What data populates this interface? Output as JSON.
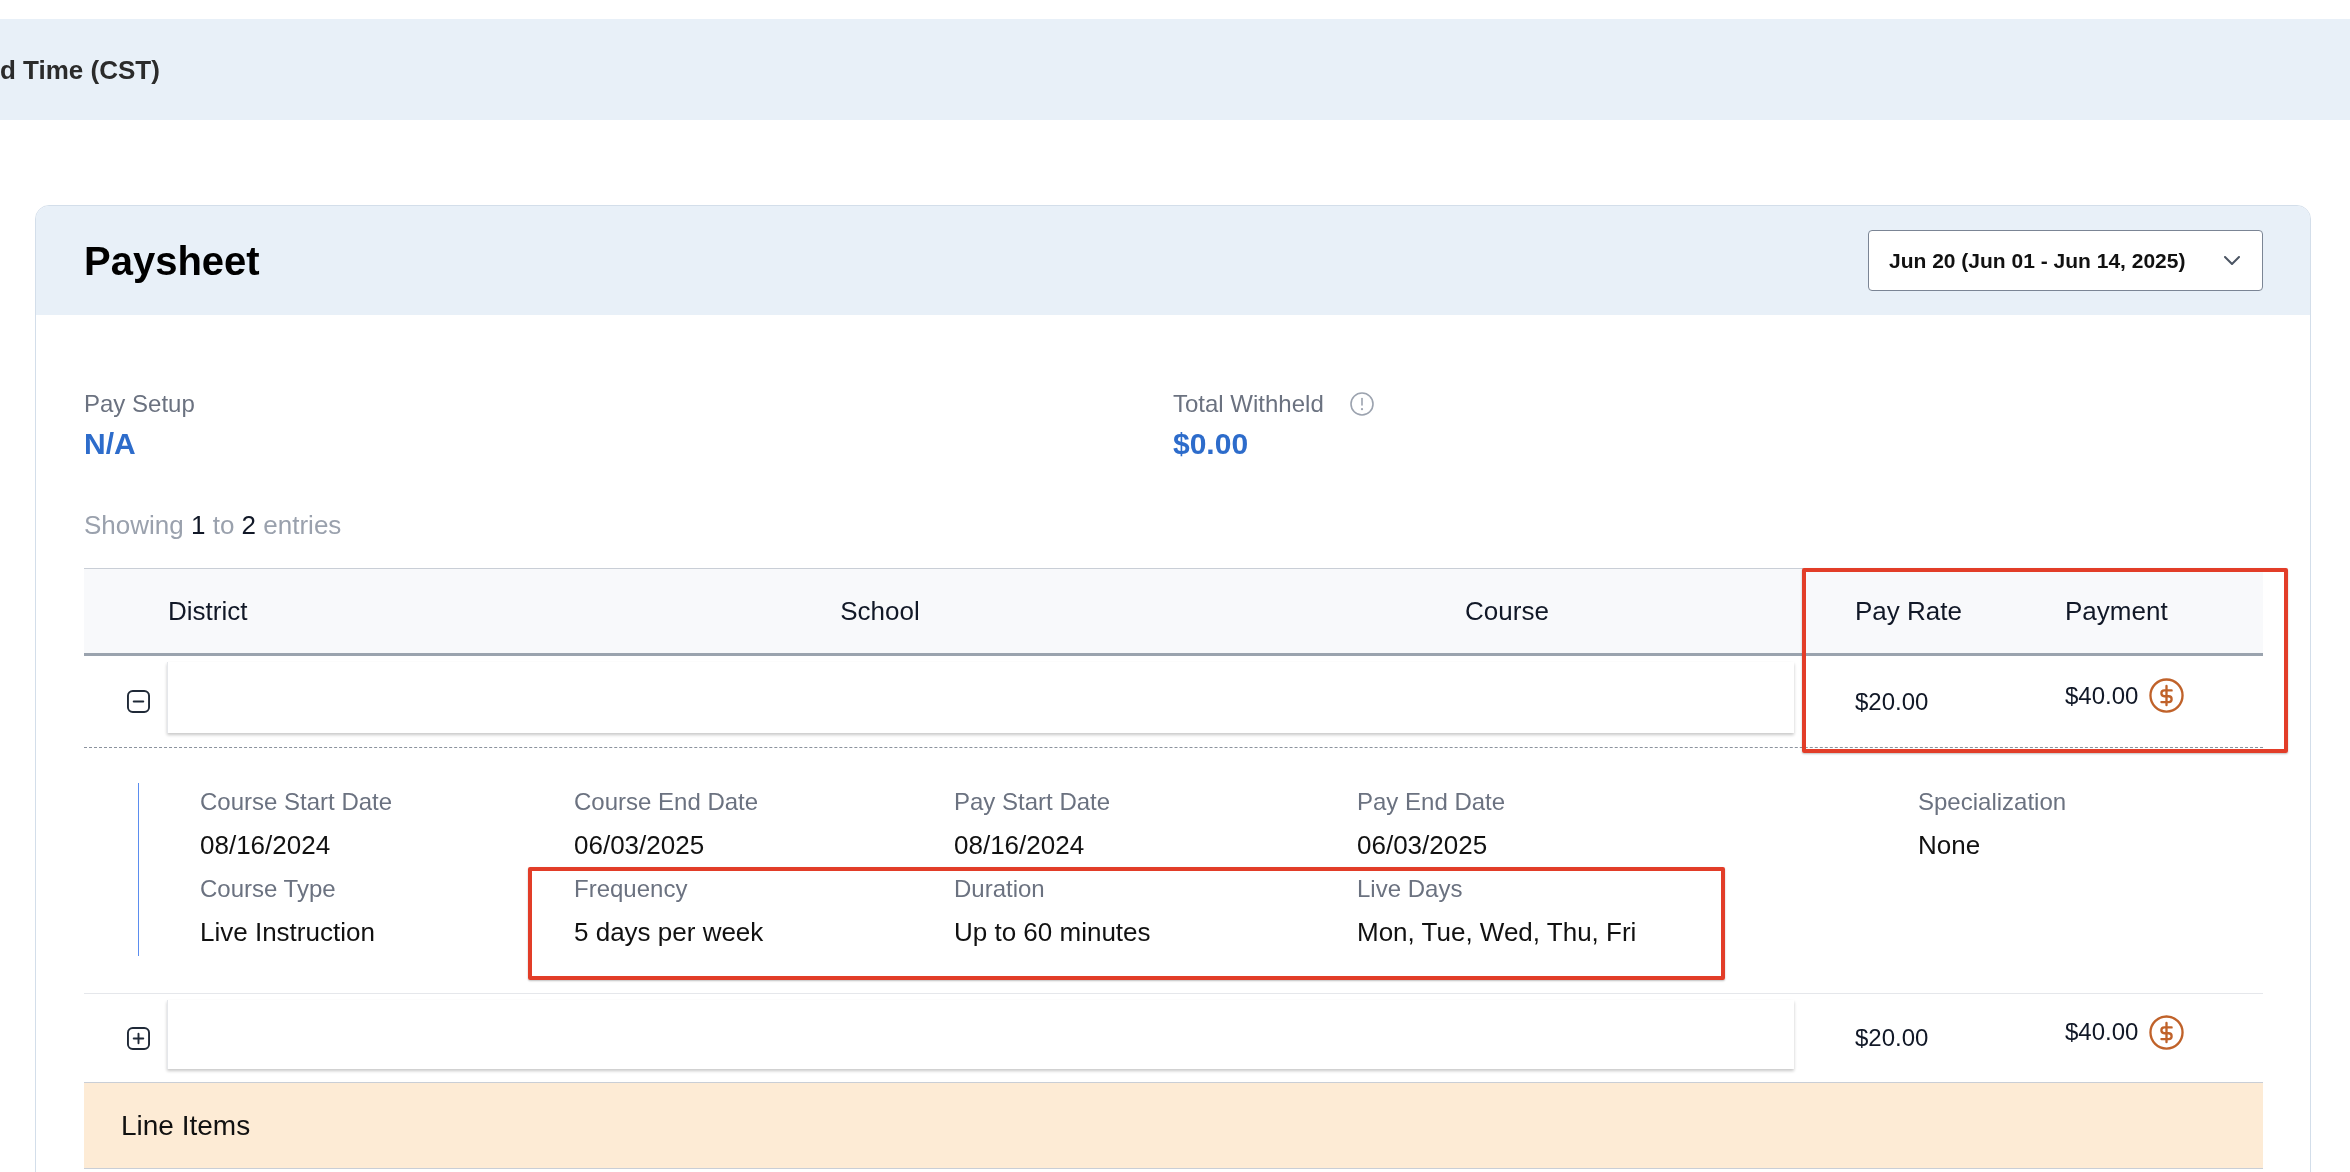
{
  "top_bar": {
    "title": "d Time (CST)"
  },
  "paysheet": {
    "title": "Paysheet",
    "period_select": {
      "value": "Jun 20 (Jun 01 - Jun 14, 2025)"
    }
  },
  "summary": [
    {
      "label": "Pay Setup",
      "value": "N/A",
      "info": false
    },
    {
      "label": "Total Withheld",
      "value": "$0.00",
      "info": true
    }
  ],
  "entries_info": {
    "prefix": "Showing",
    "start": "1",
    "middle": "to",
    "end": "2",
    "suffix": "entries"
  },
  "table": {
    "columns": [
      "District",
      "School",
      "Course",
      "Pay Rate",
      "Payment"
    ],
    "rows": [
      {
        "expanded": true,
        "pay_rate": "$20.00",
        "payment": "$40.00",
        "details": [
          [
            {
              "label": "Course Start Date",
              "value": "08/16/2024"
            },
            {
              "label": "Course End Date",
              "value": "06/03/2025"
            },
            {
              "label": "Pay Start Date",
              "value": "08/16/2024"
            },
            {
              "label": "Pay End Date",
              "value": "06/03/2025"
            },
            {
              "label": "Specialization",
              "value": "None"
            }
          ],
          [
            {
              "label": "Course Type",
              "value": "Live Instruction"
            },
            {
              "label": "Frequency",
              "value": "5 days per week"
            },
            {
              "label": "Duration",
              "value": "Up to 60 minutes"
            },
            {
              "label": "Live Days",
              "value": "Mon, Tue, Wed, Thu, Fri"
            }
          ]
        ]
      },
      {
        "expanded": false,
        "pay_rate": "$20.00",
        "payment": "$40.00"
      }
    ]
  },
  "line_items": {
    "title": "Line Items"
  }
}
